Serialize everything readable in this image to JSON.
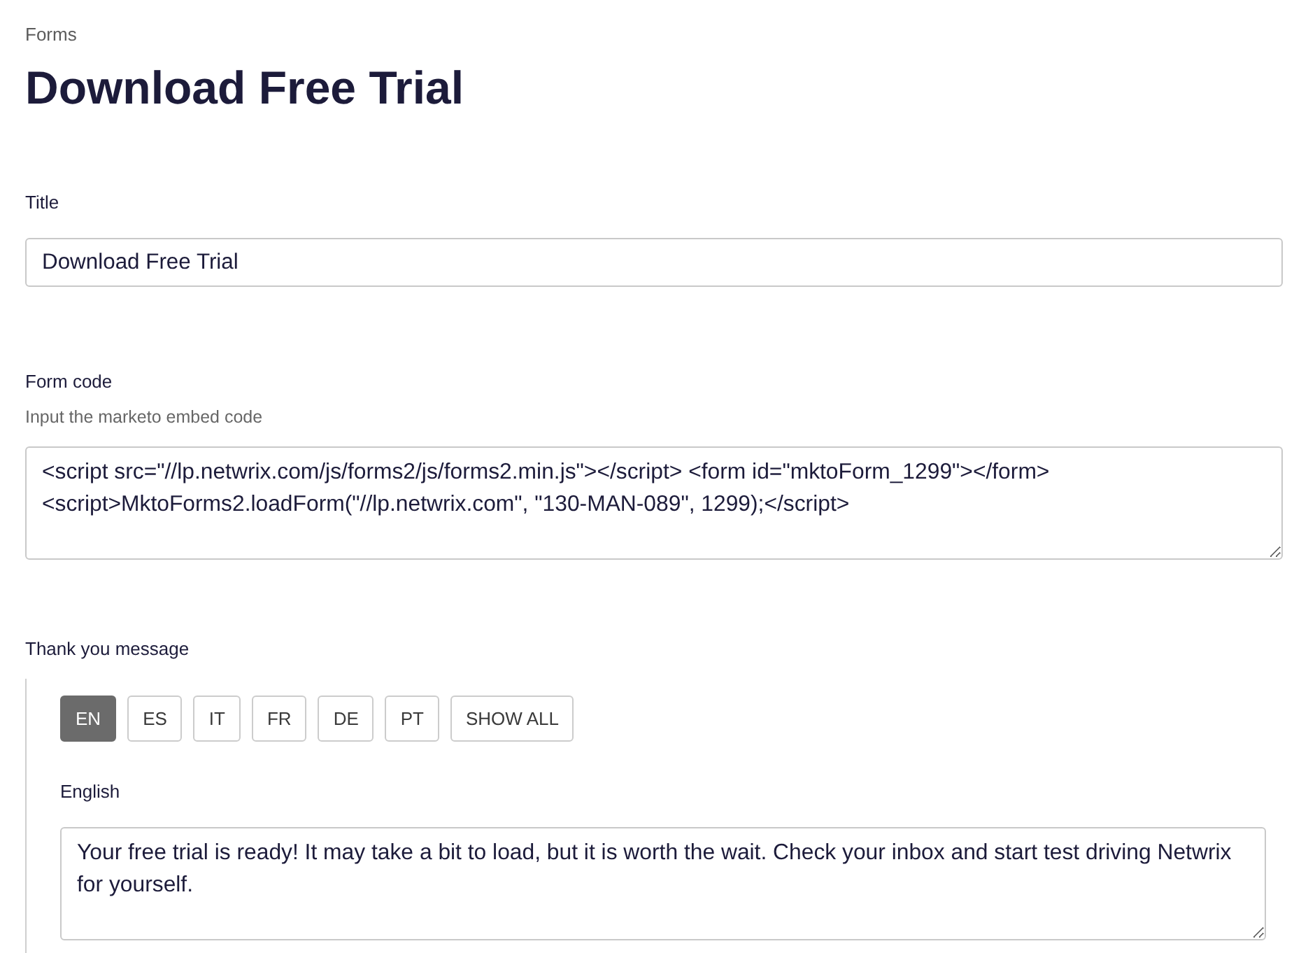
{
  "breadcrumb": "Forms",
  "heading": "Download Free Trial",
  "fields": [
    {
      "kind": "text",
      "label": "Title",
      "value": "Download Free Trial"
    },
    {
      "kind": "textarea",
      "label": "Form code",
      "help": "Input the marketo embed code",
      "value": "<script src=\"//lp.netwrix.com/js/forms2/js/forms2.min.js\"></script> <form id=\"mktoForm_1299\"></form> <script>MktoForms2.loadForm(\"//lp.netwrix.com\", \"130-MAN-089\", 1299);</script>"
    }
  ],
  "thank_you": {
    "label": "Thank you message",
    "tabs": [
      {
        "label": "EN",
        "selected": true
      },
      {
        "label": "ES",
        "selected": false
      },
      {
        "label": "IT",
        "selected": false
      },
      {
        "label": "FR",
        "selected": false
      },
      {
        "label": "DE",
        "selected": false
      },
      {
        "label": "PT",
        "selected": false
      },
      {
        "label": "SHOW ALL",
        "selected": false
      }
    ],
    "message": {
      "label": "English",
      "value": "Your free trial is ready! It may take a bit to load, but it is worth the wait. Check your inbox and start test driving Netwrix for yourself."
    }
  }
}
